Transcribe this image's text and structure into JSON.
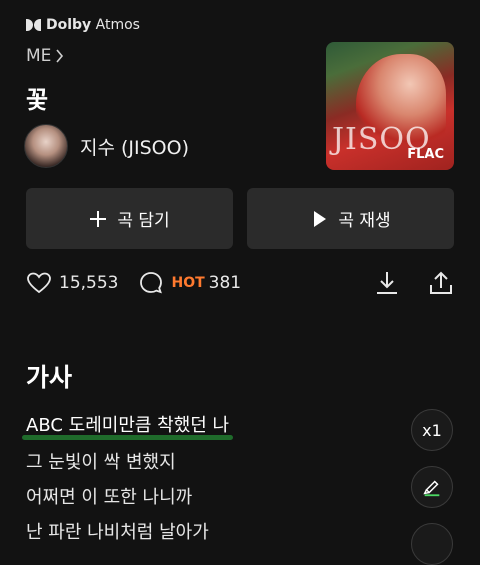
{
  "header": {
    "dolby_brand": "Dolby",
    "dolby_suffix": "Atmos"
  },
  "album": {
    "name": "ME"
  },
  "song": {
    "title": "꽃"
  },
  "artist": {
    "name": "지수 (JISOO)"
  },
  "cover": {
    "art_text": "JISOO",
    "quality_badge": "FLAC"
  },
  "actions": {
    "add_label": "곡 담기",
    "play_label": "곡 재생"
  },
  "stats": {
    "likes": "15,553",
    "hot_badge": "HOT",
    "comments": "381"
  },
  "lyrics": {
    "heading": "가사",
    "lines": [
      "ABC 도레미만큼 착했던 나",
      "그 눈빛이 싹 변했지",
      "어쩌면 이 또한 나니까",
      "난 파란 나비처럼 날아가"
    ],
    "speed_label": "x1"
  },
  "colors": {
    "accent_hot": "#ff7a2f",
    "highlight": "#1f6b2b",
    "background": "#121212"
  }
}
